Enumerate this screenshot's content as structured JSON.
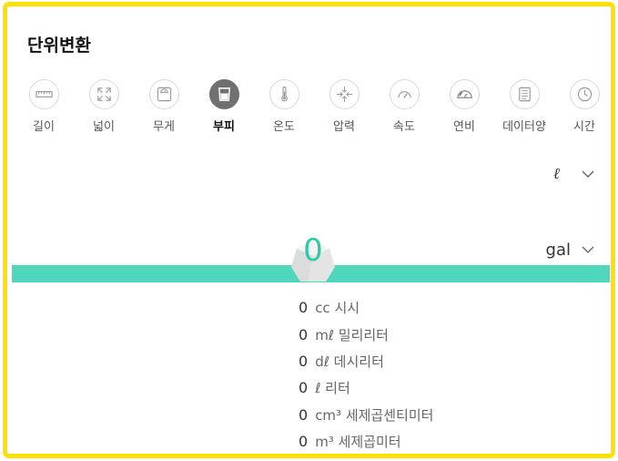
{
  "title": "단위변환",
  "colors": {
    "frame": "#ffe000",
    "accent": "#4fd7bd",
    "value": "#2fc9a7",
    "active_icon_bg": "#707070"
  },
  "categories": [
    {
      "label": "길이",
      "icon": "ruler-icon",
      "active": false
    },
    {
      "label": "넓이",
      "icon": "expand-icon",
      "active": false
    },
    {
      "label": "무게",
      "icon": "scale-icon",
      "active": false
    },
    {
      "label": "부피",
      "icon": "beaker-icon",
      "active": true
    },
    {
      "label": "온도",
      "icon": "thermometer-icon",
      "active": false
    },
    {
      "label": "압력",
      "icon": "compress-icon",
      "active": false
    },
    {
      "label": "속도",
      "icon": "speedometer-icon",
      "active": false
    },
    {
      "label": "연비",
      "icon": "fuel-gauge-icon",
      "active": false
    },
    {
      "label": "데이터양",
      "icon": "document-icon",
      "active": false
    },
    {
      "label": "시간",
      "icon": "clock-icon",
      "active": false
    }
  ],
  "from_unit": "ℓ",
  "to_unit": "gal",
  "input_value": "0",
  "results": [
    {
      "value": "0",
      "unit": "cc 시시"
    },
    {
      "value": "0",
      "unit": "mℓ 밀리리터"
    },
    {
      "value": "0",
      "unit": "dℓ 데시리터"
    },
    {
      "value": "0",
      "unit": "ℓ 리터"
    },
    {
      "value": "0",
      "unit": "cm³ 세제곱센티미터"
    },
    {
      "value": "0",
      "unit": "m³ 세제곱미터"
    }
  ]
}
